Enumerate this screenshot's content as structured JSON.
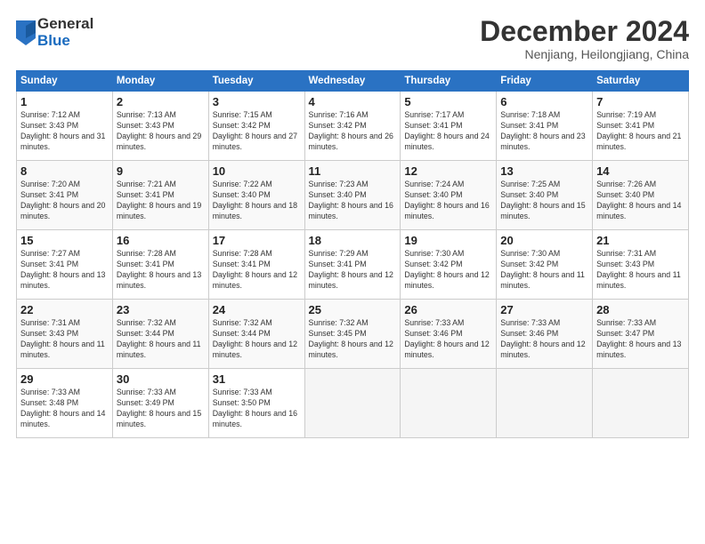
{
  "logo": {
    "general": "General",
    "blue": "Blue"
  },
  "title": "December 2024",
  "subtitle": "Nenjiang, Heilongjiang, China",
  "weekdays": [
    "Sunday",
    "Monday",
    "Tuesday",
    "Wednesday",
    "Thursday",
    "Friday",
    "Saturday"
  ],
  "weeks": [
    [
      {
        "day": "1",
        "rise": "Sunrise: 7:12 AM",
        "set": "Sunset: 3:43 PM",
        "daylight": "Daylight: 8 hours and 31 minutes."
      },
      {
        "day": "2",
        "rise": "Sunrise: 7:13 AM",
        "set": "Sunset: 3:43 PM",
        "daylight": "Daylight: 8 hours and 29 minutes."
      },
      {
        "day": "3",
        "rise": "Sunrise: 7:15 AM",
        "set": "Sunset: 3:42 PM",
        "daylight": "Daylight: 8 hours and 27 minutes."
      },
      {
        "day": "4",
        "rise": "Sunrise: 7:16 AM",
        "set": "Sunset: 3:42 PM",
        "daylight": "Daylight: 8 hours and 26 minutes."
      },
      {
        "day": "5",
        "rise": "Sunrise: 7:17 AM",
        "set": "Sunset: 3:41 PM",
        "daylight": "Daylight: 8 hours and 24 minutes."
      },
      {
        "day": "6",
        "rise": "Sunrise: 7:18 AM",
        "set": "Sunset: 3:41 PM",
        "daylight": "Daylight: 8 hours and 23 minutes."
      },
      {
        "day": "7",
        "rise": "Sunrise: 7:19 AM",
        "set": "Sunset: 3:41 PM",
        "daylight": "Daylight: 8 hours and 21 minutes."
      }
    ],
    [
      {
        "day": "8",
        "rise": "Sunrise: 7:20 AM",
        "set": "Sunset: 3:41 PM",
        "daylight": "Daylight: 8 hours and 20 minutes."
      },
      {
        "day": "9",
        "rise": "Sunrise: 7:21 AM",
        "set": "Sunset: 3:41 PM",
        "daylight": "Daylight: 8 hours and 19 minutes."
      },
      {
        "day": "10",
        "rise": "Sunrise: 7:22 AM",
        "set": "Sunset: 3:40 PM",
        "daylight": "Daylight: 8 hours and 18 minutes."
      },
      {
        "day": "11",
        "rise": "Sunrise: 7:23 AM",
        "set": "Sunset: 3:40 PM",
        "daylight": "Daylight: 8 hours and 16 minutes."
      },
      {
        "day": "12",
        "rise": "Sunrise: 7:24 AM",
        "set": "Sunset: 3:40 PM",
        "daylight": "Daylight: 8 hours and 16 minutes."
      },
      {
        "day": "13",
        "rise": "Sunrise: 7:25 AM",
        "set": "Sunset: 3:40 PM",
        "daylight": "Daylight: 8 hours and 15 minutes."
      },
      {
        "day": "14",
        "rise": "Sunrise: 7:26 AM",
        "set": "Sunset: 3:40 PM",
        "daylight": "Daylight: 8 hours and 14 minutes."
      }
    ],
    [
      {
        "day": "15",
        "rise": "Sunrise: 7:27 AM",
        "set": "Sunset: 3:41 PM",
        "daylight": "Daylight: 8 hours and 13 minutes."
      },
      {
        "day": "16",
        "rise": "Sunrise: 7:28 AM",
        "set": "Sunset: 3:41 PM",
        "daylight": "Daylight: 8 hours and 13 minutes."
      },
      {
        "day": "17",
        "rise": "Sunrise: 7:28 AM",
        "set": "Sunset: 3:41 PM",
        "daylight": "Daylight: 8 hours and 12 minutes."
      },
      {
        "day": "18",
        "rise": "Sunrise: 7:29 AM",
        "set": "Sunset: 3:41 PM",
        "daylight": "Daylight: 8 hours and 12 minutes."
      },
      {
        "day": "19",
        "rise": "Sunrise: 7:30 AM",
        "set": "Sunset: 3:42 PM",
        "daylight": "Daylight: 8 hours and 12 minutes."
      },
      {
        "day": "20",
        "rise": "Sunrise: 7:30 AM",
        "set": "Sunset: 3:42 PM",
        "daylight": "Daylight: 8 hours and 11 minutes."
      },
      {
        "day": "21",
        "rise": "Sunrise: 7:31 AM",
        "set": "Sunset: 3:43 PM",
        "daylight": "Daylight: 8 hours and 11 minutes."
      }
    ],
    [
      {
        "day": "22",
        "rise": "Sunrise: 7:31 AM",
        "set": "Sunset: 3:43 PM",
        "daylight": "Daylight: 8 hours and 11 minutes."
      },
      {
        "day": "23",
        "rise": "Sunrise: 7:32 AM",
        "set": "Sunset: 3:44 PM",
        "daylight": "Daylight: 8 hours and 11 minutes."
      },
      {
        "day": "24",
        "rise": "Sunrise: 7:32 AM",
        "set": "Sunset: 3:44 PM",
        "daylight": "Daylight: 8 hours and 12 minutes."
      },
      {
        "day": "25",
        "rise": "Sunrise: 7:32 AM",
        "set": "Sunset: 3:45 PM",
        "daylight": "Daylight: 8 hours and 12 minutes."
      },
      {
        "day": "26",
        "rise": "Sunrise: 7:33 AM",
        "set": "Sunset: 3:46 PM",
        "daylight": "Daylight: 8 hours and 12 minutes."
      },
      {
        "day": "27",
        "rise": "Sunrise: 7:33 AM",
        "set": "Sunset: 3:46 PM",
        "daylight": "Daylight: 8 hours and 12 minutes."
      },
      {
        "day": "28",
        "rise": "Sunrise: 7:33 AM",
        "set": "Sunset: 3:47 PM",
        "daylight": "Daylight: 8 hours and 13 minutes."
      }
    ],
    [
      {
        "day": "29",
        "rise": "Sunrise: 7:33 AM",
        "set": "Sunset: 3:48 PM",
        "daylight": "Daylight: 8 hours and 14 minutes."
      },
      {
        "day": "30",
        "rise": "Sunrise: 7:33 AM",
        "set": "Sunset: 3:49 PM",
        "daylight": "Daylight: 8 hours and 15 minutes."
      },
      {
        "day": "31",
        "rise": "Sunrise: 7:33 AM",
        "set": "Sunset: 3:50 PM",
        "daylight": "Daylight: 8 hours and 16 minutes."
      },
      null,
      null,
      null,
      null
    ]
  ]
}
